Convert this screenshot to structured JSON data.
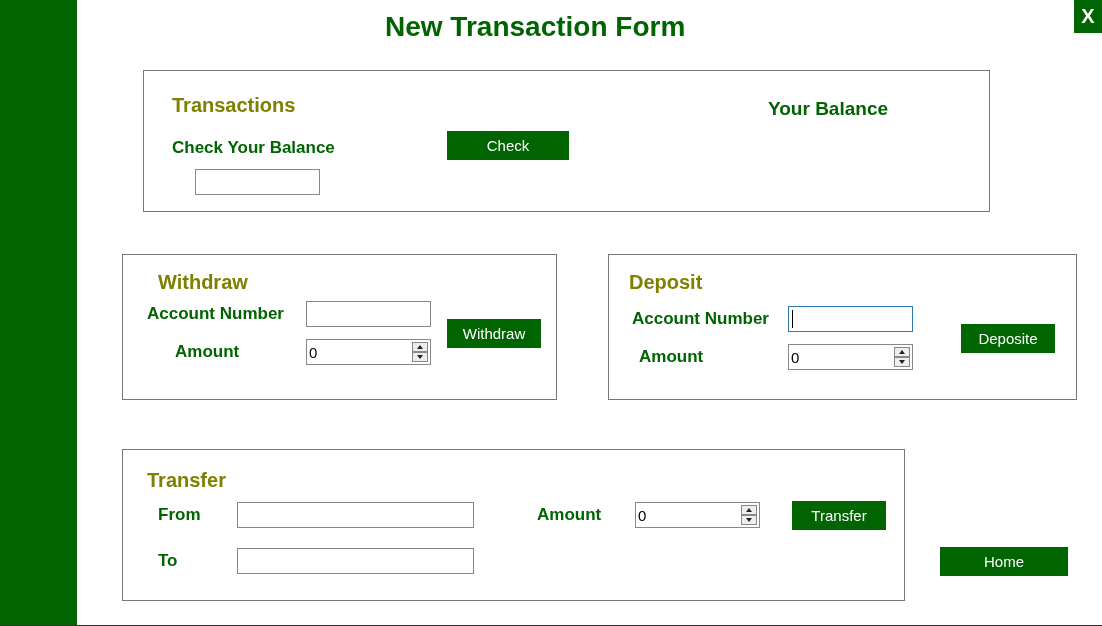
{
  "window": {
    "title": "New Transaction Form",
    "close": "X"
  },
  "balance_panel": {
    "title": "Transactions",
    "label": "Check Your Balance",
    "button": "Check",
    "balance_label": "Your Balance"
  },
  "withdraw": {
    "title": "Withdraw",
    "account_label": "Account Number",
    "account_focused": false,
    "amount_label": "Amount",
    "amount": "0",
    "button": "Withdraw"
  },
  "deposit": {
    "title": "Deposit",
    "account_label": "Account Number",
    "account_focused": true,
    "amount_label": "Amount",
    "amount": "0",
    "button": "Deposite"
  },
  "transfer": {
    "title": "Transfer",
    "from_label": "From",
    "to_label": "To",
    "amount_label": "Amount",
    "amount": "0",
    "button": "Transfer"
  },
  "home_button": "Home"
}
